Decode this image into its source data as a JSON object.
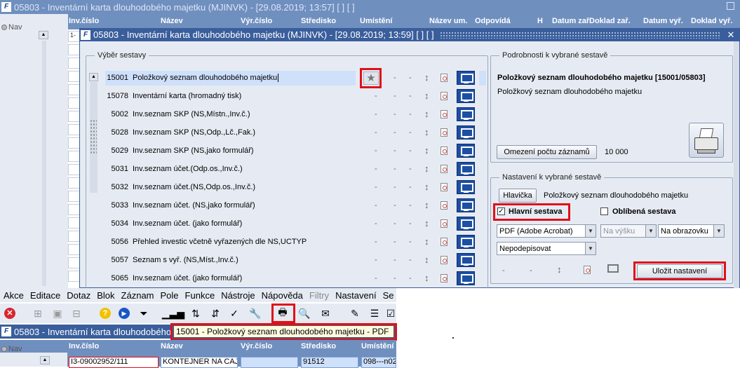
{
  "background_window": {
    "title": "05803 - Inventární karta dlouhodobého majetku (MJINVK) - [29.08.2019; 13:57]  [ ]  [ ]",
    "nav_label": "Nav",
    "columns": [
      "Inv.číslo",
      "Název",
      "Výr.číslo",
      "Středisko",
      "Umístění",
      "Název um.",
      "Odpovídá",
      "H",
      "Datum zař.",
      "Doklad zař.",
      "Datum vyř.",
      "Doklad vyř."
    ],
    "first_cell": "1-"
  },
  "dialog": {
    "title": "05803 - Inventární karta dlouhodobého majetku (MJINVK) - [29.08.2019; 13:59]  [ ]  [ ]",
    "report_group_label": "Výběr sestavy",
    "reports": [
      {
        "code": "15001",
        "name": "Položkový seznam dlouhodobého majetku"
      },
      {
        "code": "15078",
        "name": "Inventární karta (hromadný tisk)"
      },
      {
        "code": "5002",
        "name": "Inv.seznam SKP (NS,Místn.,Inv.č.)"
      },
      {
        "code": "5028",
        "name": "Inv.seznam SKP (NS,Odp.,Lč.,Fak.)"
      },
      {
        "code": "5029",
        "name": "Inv.seznam SKP (NS,jako formulář)"
      },
      {
        "code": "5031",
        "name": "Inv.seznam účet.(Odp.os.,Inv.č.)"
      },
      {
        "code": "5032",
        "name": "Inv.seznam účet.(NS,Odp.os.,Inv.č.)"
      },
      {
        "code": "5033",
        "name": "Inv.seznam účet. (NS,jako formulář)"
      },
      {
        "code": "5034",
        "name": "Inv.seznam účet. (jako formulář)"
      },
      {
        "code": "5056",
        "name": "Přehled investic včetně vyřazených dle NS,UCTYP"
      },
      {
        "code": "5057",
        "name": "Seznam s vyř. (NS,Míst.,Inv.č.)"
      },
      {
        "code": "5065",
        "name": "Inv.seznam účet. (jako formulář)"
      }
    ],
    "dash": "-",
    "details_group_label": "Podrobnosti k vybrané sestavě",
    "details_title": "Položkový seznam dlouhodobého majetku [15001/05803]",
    "details_subtitle": "Položkový seznam dlouhodobého majetku",
    "limit_button": "Omezení počtu záznamů",
    "limit_value": "10 000",
    "settings_group_label": "Nastavení k vybrané sestavě",
    "header_button": "Hlavička",
    "header_value": "Položkový seznam dlouhodobého majetku",
    "main_report_label": "Hlavní sestava",
    "main_report_checked": true,
    "favorite_label": "Oblíbená sestava",
    "favorite_checked": false,
    "format_select": "PDF (Adobe Acrobat)",
    "height_select": "Na výšku",
    "output_select": "Na obrazovku",
    "sign_select": "Nepodepisovat",
    "save_button": "Uložit nastavení"
  },
  "menu": {
    "items": [
      "Akce",
      "Editace",
      "Dotaz",
      "Blok",
      "Záznam",
      "Pole",
      "Funkce",
      "Nástroje",
      "Nápověda",
      "Filtry",
      "Nastavení",
      "Se"
    ]
  },
  "bottom_window": {
    "title": "05803 - Inventární karta dlouhodobého m",
    "tooltip": "15001 - Položkový seznam dlouhodobého majetku - PDF",
    "columns": [
      "Inv.číslo",
      "Název",
      "Výr.číslo",
      "Středisko",
      "Umístění"
    ],
    "row": [
      "I3-09002952/111",
      "KONTEJNER NA CAJ",
      "",
      "91512",
      "098---n02"
    ]
  },
  "colors": {
    "title_blue": "#3a5e9c",
    "panel": "#e6ebf3",
    "selection": "#cfe0fb",
    "highlight_red": "#e0101a"
  }
}
